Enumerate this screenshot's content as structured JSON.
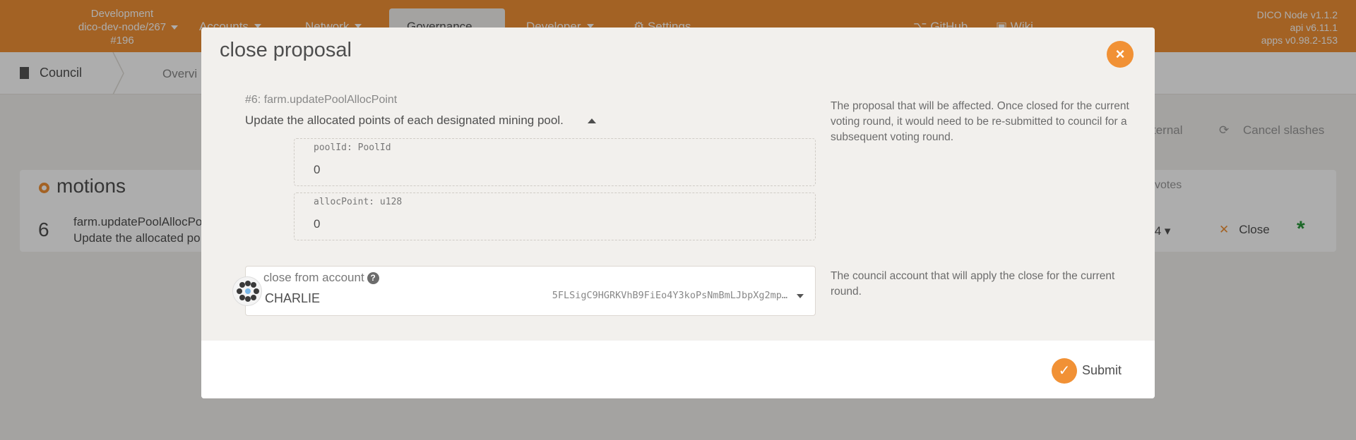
{
  "topbar": {
    "chain": {
      "name": "Development",
      "node": "dico-dev-node/267",
      "block": "#196"
    },
    "nav": [
      {
        "label": "Accounts"
      },
      {
        "label": "Network"
      },
      {
        "label": "Governance"
      },
      {
        "label": "Developer"
      },
      {
        "label": "Settings"
      },
      {
        "label": "GitHub"
      },
      {
        "label": "Wiki"
      }
    ],
    "node_info": {
      "version": "DICO Node v1.1.2",
      "api": "api v6.11.1",
      "apps": "apps v0.98.2-153"
    }
  },
  "subnav": {
    "title": "Council",
    "tab": "Overvi"
  },
  "page": {
    "actions": {
      "external": "ternal",
      "cancel_slashes": "Cancel slashes"
    },
    "motions": {
      "title": "motions",
      "votes_header": "votes",
      "row": {
        "index": "6",
        "title": "farm.updatePoolAllocPo",
        "desc": "Update the allocated po",
        "votes": "/4",
        "close_label": "Close"
      }
    }
  },
  "modal": {
    "title": "close proposal",
    "close_icon": "×",
    "proposal": {
      "label": "#6: farm.updatePoolAllocPoint",
      "summary": "Update the allocated points of each designated mining pool.",
      "params": [
        {
          "label": "poolId: PoolId",
          "value": "0"
        },
        {
          "label": "allocPoint: u128",
          "value": "0"
        }
      ],
      "help": "The proposal that will be affected. Once closed for the current voting round, it would need to be re-submitted to council for a subsequent voting round."
    },
    "account": {
      "label": "close from account",
      "help_icon": "?",
      "name": "CHARLIE",
      "address": "5FLSigC9HGRKVhB9FiEo4Y3koPsNmBmLJbpXg2mp…",
      "help": "The council account that will apply the close for the current round."
    },
    "submit_label": "Submit",
    "submit_icon": "✓"
  },
  "colors": {
    "accent": "#f19135",
    "success": "#2a9a3c"
  }
}
